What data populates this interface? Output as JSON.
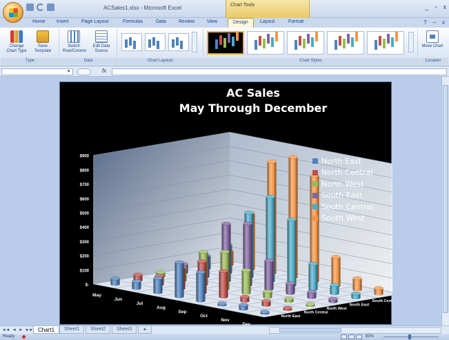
{
  "window": {
    "title": "ACSales1.xlsx - Microsoft Excel",
    "contextual_group": "Chart Tools",
    "controls": [
      "_",
      "▫",
      "x"
    ]
  },
  "tabs": [
    "Home",
    "Insert",
    "Page Layout",
    "Formulas",
    "Data",
    "Review",
    "View",
    "Design",
    "Layout",
    "Format"
  ],
  "active_tab": "Design",
  "ribbon": {
    "type_group": {
      "label": "Type",
      "change_chart_type": "Change Chart Type",
      "save_template": "Save Template"
    },
    "data_group": {
      "label": "Data",
      "switch_row_column": "Switch Row/Column",
      "edit_data_source": "Edit Data Source"
    },
    "chart_layouts_group": {
      "label": "Chart Layouts"
    },
    "chart_styles_group": {
      "label": "Chart Styles"
    },
    "location_group": {
      "label": "Location",
      "move_chart": "Move Chart"
    }
  },
  "formula_bar": {
    "fx": "fx",
    "name_box": "",
    "formula": ""
  },
  "chart_data": {
    "type": "bar",
    "subtype": "3d-column",
    "title": "AC Sales",
    "subtitle": "May Through December",
    "categories": [
      "May",
      "Jun",
      "Jul",
      "Aug",
      "Sep",
      "Oct",
      "Nov",
      "Dec"
    ],
    "series": [
      {
        "name": "North East",
        "color": "#4f81bd",
        "values": [
          40,
          50,
          100,
          240,
          200,
          10,
          30,
          10
        ]
      },
      {
        "name": "North Central",
        "color": "#c0504d",
        "values": [
          40,
          60,
          150,
          220,
          180,
          30,
          30,
          10
        ]
      },
      {
        "name": "North West",
        "color": "#9bbb59",
        "values": [
          30,
          90,
          230,
          260,
          160,
          40,
          20,
          10
        ]
      },
      {
        "name": "South East",
        "color": "#8064a2",
        "values": [
          60,
          150,
          400,
          430,
          200,
          70,
          40,
          20
        ]
      },
      {
        "name": "South Central",
        "color": "#4bacc6",
        "values": [
          90,
          200,
          450,
          590,
          460,
          180,
          60,
          30
        ]
      },
      {
        "name": "South West",
        "color": "#f79646",
        "values": [
          100,
          390,
          780,
          840,
          740,
          200,
          80,
          40
        ]
      }
    ],
    "ylabel": "",
    "yticks": [
      "$-",
      "$100",
      "$200",
      "$300",
      "$400",
      "$500",
      "$600",
      "$700",
      "$800",
      "$900"
    ],
    "ylim": [
      0,
      900
    ],
    "grid": true,
    "legend_position": "right",
    "depth_labels": [
      "North East",
      "North Central",
      "North West",
      "South East",
      "South Central",
      "South West"
    ]
  },
  "sheets": [
    "Chart1",
    "Sheet1",
    "Sheet2",
    "Sheet3"
  ],
  "active_sheet": "Chart1",
  "status": {
    "text": "Ready",
    "zoom": "83%"
  }
}
